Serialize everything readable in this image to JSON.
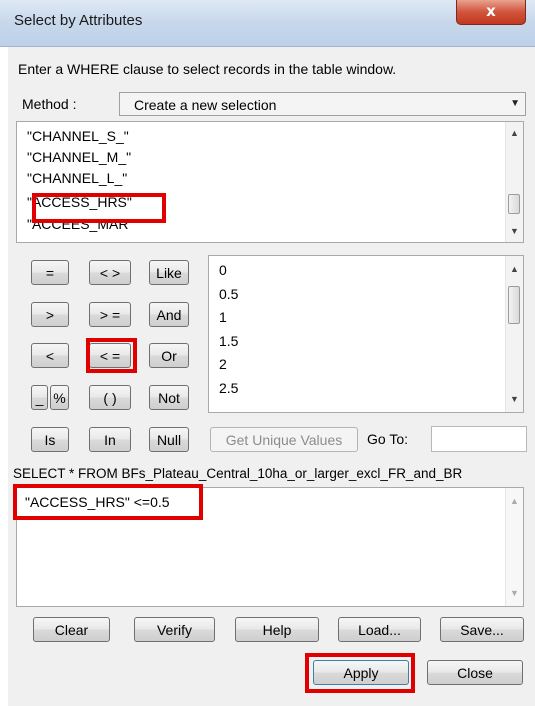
{
  "window": {
    "title": "Select by Attributes",
    "close_glyph": "x"
  },
  "instructions": "Enter a WHERE clause to select records in the table window.",
  "method": {
    "label": "Method :",
    "value": "Create a new selection"
  },
  "fields": [
    "\"CHANNEL_S_\"",
    "\"CHANNEL_M_\"",
    "\"CHANNEL_L_\"",
    "\"ACCESS_HRS\"",
    "\"ACCEES_MAR\""
  ],
  "operators": {
    "eq": "=",
    "ne": "< >",
    "like": "Like",
    "gt": ">",
    "ge": "> =",
    "and": "And",
    "lt": "<",
    "le": "< =",
    "or": "Or",
    "underscore": "_",
    "percent": "%",
    "parens": "( )",
    "not": "Not",
    "is": "Is",
    "in": "In",
    "null": "Null"
  },
  "values": [
    "0",
    "0.5",
    "1",
    "1.5",
    "2",
    "2.5"
  ],
  "unique_button": "Get Unique Values",
  "goto_label": "Go To:",
  "goto_value": "",
  "sql_prefix": "SELECT * FROM BFs_Plateau_Central_10ha_or_larger_excl_FR_and_BR",
  "expression": "\"ACCESS_HRS\" <=0.5",
  "buttons": {
    "clear": "Clear",
    "verify": "Verify",
    "help": "Help",
    "load": "Load...",
    "save": "Save...",
    "apply": "Apply",
    "close": "Close"
  },
  "colors": {
    "highlight": "#e00000",
    "dialog_bg": "#f0f0f0"
  }
}
